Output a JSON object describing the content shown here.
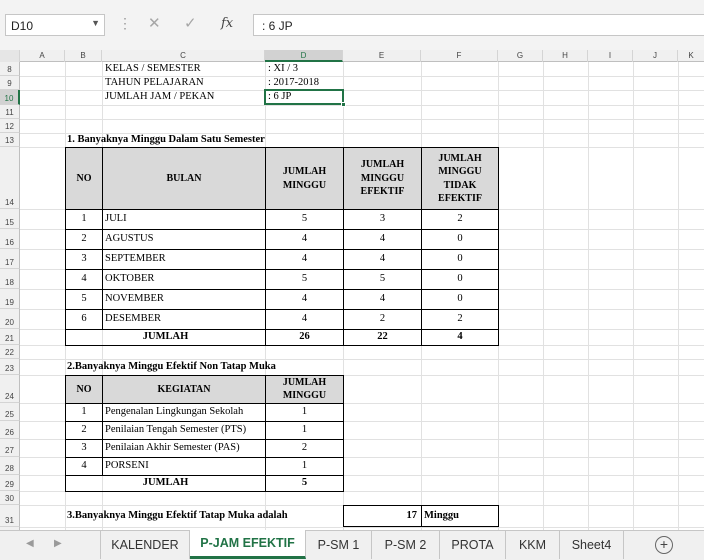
{
  "formula_bar": {
    "name_box": "D10",
    "formula": ": 6 JP",
    "cancel_icon": "cancel-icon",
    "enter_icon": "check-icon",
    "function_label": "fx"
  },
  "columns": [
    "A",
    "B",
    "C",
    "D",
    "E",
    "F",
    "G",
    "H",
    "I",
    "J",
    "K"
  ],
  "rows": [
    "8",
    "9",
    "10",
    "11",
    "12",
    "13",
    "14",
    "15",
    "16",
    "17",
    "18",
    "19",
    "20",
    "21",
    "22",
    "23",
    "24",
    "25",
    "26",
    "27",
    "28",
    "29",
    "30",
    "31"
  ],
  "info": {
    "kelas_label": "KELAS / SEMESTER",
    "kelas_value": ": XI / 3",
    "tahun_label": "TAHUN PELAJARAN",
    "tahun_value": ": 2017-2018",
    "jam_label": "JUMLAH JAM / PEKAN",
    "jam_value": ": 6 JP"
  },
  "section1": {
    "title": "1. Banyaknya Minggu Dalam Satu Semester",
    "headers": [
      "NO",
      "BULAN",
      "JUMLAH MINGGU",
      "JUMLAH MINGGU EFEKTIF",
      "JUMLAH MINGGU TIDAK EFEKTIF"
    ],
    "rows": [
      {
        "no": "1",
        "bulan": "JULI",
        "jm": "5",
        "jme": "3",
        "jmte": "2"
      },
      {
        "no": "2",
        "bulan": "AGUSTUS",
        "jm": "4",
        "jme": "4",
        "jmte": "0"
      },
      {
        "no": "3",
        "bulan": "SEPTEMBER",
        "jm": "4",
        "jme": "4",
        "jmte": "0"
      },
      {
        "no": "4",
        "bulan": "OKTOBER",
        "jm": "5",
        "jme": "5",
        "jmte": "0"
      },
      {
        "no": "5",
        "bulan": "NOVEMBER",
        "jm": "4",
        "jme": "4",
        "jmte": "0"
      },
      {
        "no": "6",
        "bulan": "DESEMBER",
        "jm": "4",
        "jme": "2",
        "jmte": "2"
      }
    ],
    "total_label": "JUMLAH",
    "total_jm": "26",
    "total_jme": "22",
    "total_jmte": "4"
  },
  "section2": {
    "title": "2.Banyaknya Minggu Efektif Non Tatap Muka",
    "headers": [
      "NO",
      "KEGIATAN",
      "JUMLAH MINGGU"
    ],
    "rows": [
      {
        "no": "1",
        "kegiatan": "Pengenalan Lingkungan Sekolah",
        "jm": "1"
      },
      {
        "no": "2",
        "kegiatan": "Penilaian Tengah Semester (PTS)",
        "jm": "1"
      },
      {
        "no": "3",
        "kegiatan": "Penilaian Akhir Semester (PAS)",
        "jm": "2"
      },
      {
        "no": "4",
        "kegiatan": "PORSENI",
        "jm": "1"
      }
    ],
    "total_label": "JUMLAH",
    "total_jm": "5"
  },
  "section3": {
    "title": "3.Banyaknya Minggu Efektif Tatap Muka adalah",
    "value": "17",
    "unit": "Minggu"
  },
  "tabs": [
    "KALENDER",
    "P-JAM EFEKTIF",
    "P-SM 1",
    "P-SM 2",
    "PROTA",
    "KKM",
    "Sheet4"
  ],
  "active_tab": "P-JAM EFEKTIF",
  "accent_color": "#217346"
}
